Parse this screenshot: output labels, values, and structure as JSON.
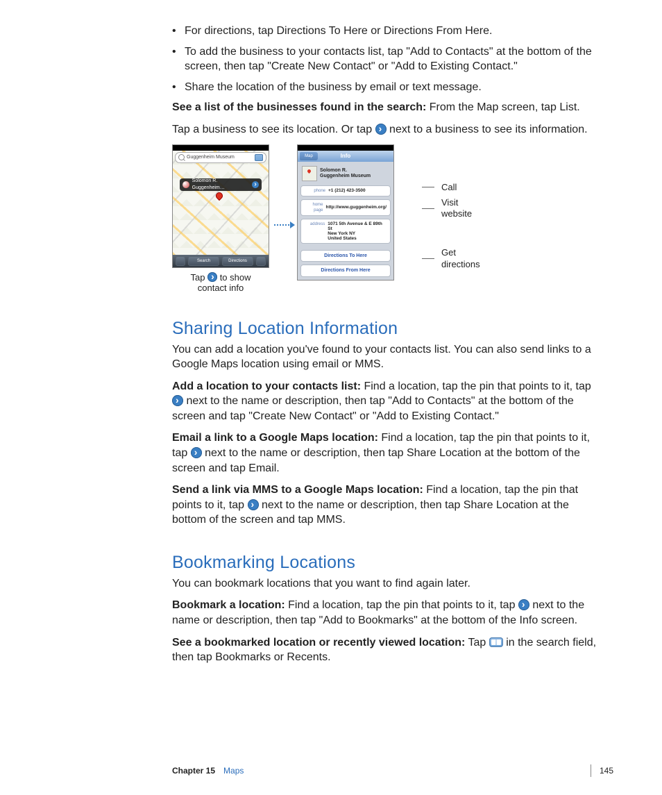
{
  "bullets": [
    "For directions, tap Directions To Here or Directions From Here.",
    "To add the business to your contacts list, tap \"Add to Contacts\" at the bottom of the screen, then tap \"Create New Contact\" or \"Add to Existing Contact.\"",
    "Share the location of the business by email or text message."
  ],
  "see_bold": "See a list of the businesses found in the search:",
  "see_rest": "  From the Map screen, tap List.",
  "tap1": "Tap a business to see its location. Or tap ",
  "tap2": " next to a business to see its information.",
  "map": {
    "search_text": "Guggenheim Museum",
    "callout_text": "Solomon R. Guggenheim…",
    "toolbar_search": "Search",
    "toolbar_directions": "Directions"
  },
  "info": {
    "back": "Map",
    "title": "Info",
    "name": "Solomon R.\nGuggenheim Museum",
    "phone_lbl": "phone",
    "phone_val": "+1 (212) 423-3500",
    "home_lbl": "home page",
    "home_val": "http://www.guggenheim.org/",
    "addr_lbl": "address",
    "addr_val": "1071 5th Avenue & E 89th St\nNew York NY\nUnited States",
    "dir_to": "Directions To Here",
    "dir_from": "Directions From Here"
  },
  "annot": {
    "call": "Call",
    "visit": "Visit\nwebsite",
    "get": "Get\ndirections"
  },
  "caption1": "Tap ",
  "caption2": " to show\ncontact info",
  "sections": {
    "share_h": "Sharing Location Information",
    "share_p": "You can add a location you've found to your contacts list. You can also send links to a Google Maps location using email or MMS.",
    "add_b": "Add a location to your contacts list:",
    "add_1": "  Find a location, tap the pin that points to it, tap ",
    "add_2": " next to the name or description, then tap \"Add to Contacts\" at the bottom of the screen and tap \"Create New Contact\" or \"Add to Existing Contact.\"",
    "email_b": "Email a link to a Google Maps location:",
    "email_1": "  Find a location, tap the pin that points to it, tap ",
    "email_2": " next to the name or description, then tap Share Location at the bottom of the screen and tap Email.",
    "mms_b": "Send a link via MMS to a Google Maps location:",
    "mms_1": "  Find a location, tap the pin that points to it, tap ",
    "mms_2": " next to the name or description, then tap Share Location at the bottom of the screen and tap MMS.",
    "book_h": "Bookmarking Locations",
    "book_p": "You can bookmark locations that you want to find again later.",
    "bk1_b": "Bookmark a location:",
    "bk1_1": "  Find a location, tap the pin that points to it, tap ",
    "bk1_2": " next to the name or description, then tap \"Add to Bookmarks\" at the bottom of the Info screen.",
    "bk2_b": "See a bookmarked location or recently viewed location:",
    "bk2_1": "  Tap ",
    "bk2_2": " in the search field, then tap Bookmarks or Recents."
  },
  "footer": {
    "chapter": "Chapter 15",
    "title": "Maps",
    "page": "145"
  }
}
